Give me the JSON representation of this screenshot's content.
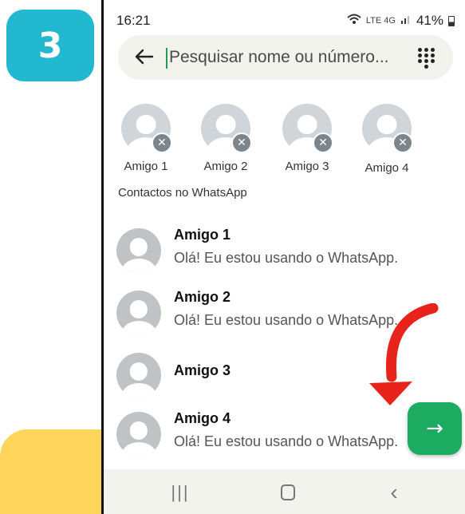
{
  "tutorial": {
    "step_number": "3"
  },
  "status_bar": {
    "time": "16:21",
    "network_small": "LTE 4G",
    "battery": "41%"
  },
  "search": {
    "placeholder": "Pesquisar nome ou número..."
  },
  "selected": [
    {
      "label": "Amigo 1"
    },
    {
      "label": "Amigo 2"
    },
    {
      "label": "Amigo 3"
    },
    {
      "label": "Amigo 4"
    }
  ],
  "section": {
    "title": "Contactos no WhatsApp"
  },
  "contacts": [
    {
      "name": "Amigo 1",
      "about": "Olá! Eu estou usando o WhatsApp."
    },
    {
      "name": "Amigo 2",
      "about": "Olá! Eu estou usando o WhatsApp."
    },
    {
      "name": "Amigo 3",
      "about": ""
    },
    {
      "name": "Amigo 4",
      "about": "Olá! Eu estou usando o WhatsApp."
    }
  ],
  "fab": {
    "icon": "arrow-right-icon",
    "symbol": "→"
  },
  "nav": {
    "recent_symbol": "|||",
    "back_symbol": "‹"
  },
  "colors": {
    "accent": "#1daa61",
    "badge": "#22b8cf",
    "highlight": "#ffd55c",
    "arrow": "#e8231b"
  }
}
